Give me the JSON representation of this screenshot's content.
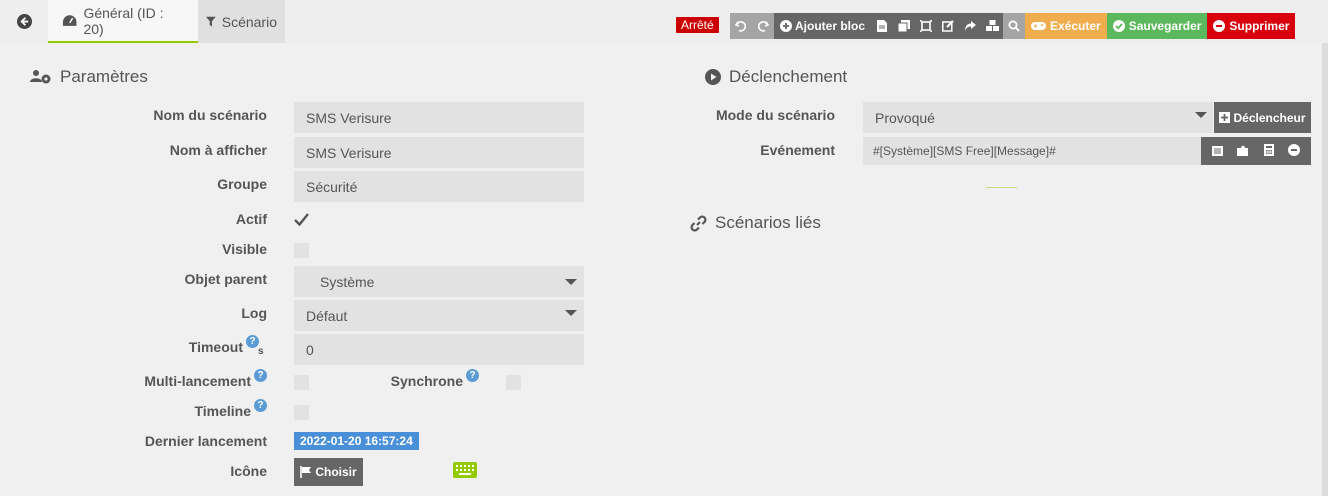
{
  "header": {
    "general_tab": "Général (ID : 20)",
    "scenario_tab": "Scénario",
    "status": "Arrêté",
    "add_block": "Ajouter bloc",
    "execute": "Exécuter",
    "save": "Sauvegarder",
    "delete": "Supprimer"
  },
  "params": {
    "title": "Paramètres",
    "name_label": "Nom du scénario",
    "name_value": "SMS Verisure",
    "display_label": "Nom à afficher",
    "display_value": "SMS Verisure",
    "group_label": "Groupe",
    "group_value": "Sécurité",
    "active_label": "Actif",
    "visible_label": "Visible",
    "parent_label": "Objet parent",
    "parent_value": "Système",
    "log_label": "Log",
    "log_value": "Défaut",
    "timeout_label": "Timeout",
    "timeout_unit": "s",
    "timeout_value": "0",
    "multi_label": "Multi-lancement",
    "sync_label": "Synchrone",
    "timeline_label": "Timeline",
    "last_run_label": "Dernier lancement",
    "last_run_value": "2022-01-20 16:57:24",
    "icon_label": "Icône",
    "choose_label": "Choisir"
  },
  "trigger": {
    "title": "Déclenchement",
    "mode_label": "Mode du scénario",
    "mode_value": "Provoqué",
    "trigger_button": "Déclencheur",
    "event_label": "Evénement",
    "event_value": "#[Système][SMS Free][Message]#"
  },
  "linked": {
    "title": "Scénarios liés"
  },
  "colors": {
    "accent": "#94ca02",
    "danger": "#d9000d",
    "warning": "#f0ad4e",
    "success": "#5cb85c",
    "info": "#4a90d9"
  }
}
